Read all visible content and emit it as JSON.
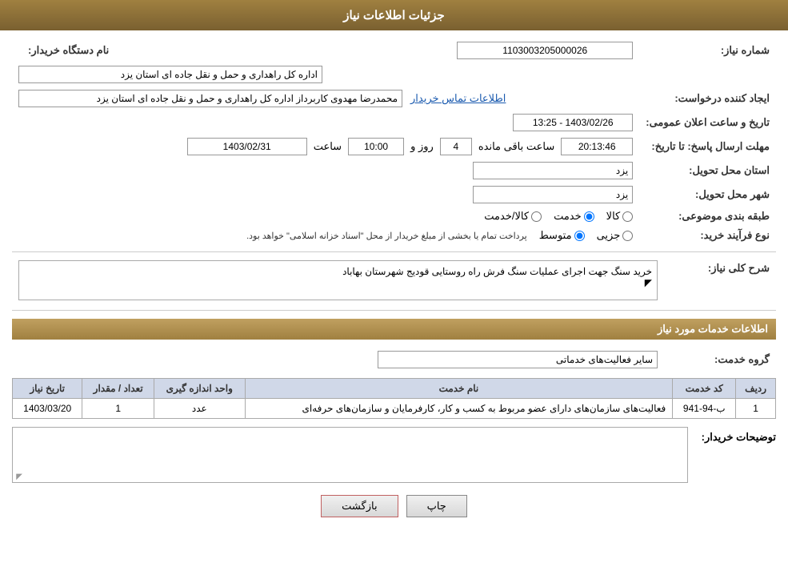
{
  "header": {
    "title": "جزئیات اطلاعات نیاز"
  },
  "main": {
    "need_number_label": "شماره نیاز:",
    "need_number_value": "1103003205000026",
    "buyer_org_label": "نام دستگاه خریدار:",
    "buyer_org_value": "اداره کل راهداری و حمل و نقل جاده ای استان یزد",
    "creator_label": "ایجاد کننده درخواست:",
    "creator_value": "محمدرضا مهدوی کاربرداز اداره کل راهداری و حمل و نقل جاده ای استان یزد",
    "creator_link": "اطلاعات تماس خریدار",
    "announce_date_label": "تاریخ و ساعت اعلان عمومی:",
    "announce_date_value": "1403/02/26 - 13:25",
    "response_date_label": "مهلت ارسال پاسخ: تا تاریخ:",
    "response_date_value": "1403/02/31",
    "response_time_label": "ساعت",
    "response_time_value": "10:00",
    "response_days_label": "روز و",
    "response_days_value": "4",
    "remaining_time_label": "ساعت باقی مانده",
    "remaining_time_value": "20:13:46",
    "province_label": "استان محل تحویل:",
    "province_value": "یزد",
    "city_label": "شهر محل تحویل:",
    "city_value": "یزد",
    "category_label": "طبقه بندی موضوعی:",
    "category_options": [
      {
        "id": "kala",
        "label": "کالا"
      },
      {
        "id": "khadamat",
        "label": "خدمت"
      },
      {
        "id": "kala_khadamat",
        "label": "کالا/خدمت"
      }
    ],
    "category_selected": "khadamat",
    "process_label": "نوع فرآیند خرید:",
    "process_options": [
      {
        "id": "jozvi",
        "label": "جزیی"
      },
      {
        "id": "motovaset",
        "label": "متوسط"
      }
    ],
    "process_selected": "motovaset",
    "process_note": "پرداخت تمام یا بخشی از مبلغ خریدار از محل \"اسناد خزانه اسلامی\" خواهد بود.",
    "description_label": "شرح کلی نیاز:",
    "description_value": "خرید سنگ جهت اجرای عملیات سنگ فرش راه روستایی قودیج شهرستان بهاباد",
    "services_section_title": "اطلاعات خدمات مورد نیاز",
    "service_group_label": "گروه خدمت:",
    "service_group_value": "سایر فعالیت‌های خدماتی",
    "table": {
      "columns": [
        "ردیف",
        "کد خدمت",
        "نام خدمت",
        "واحد اندازه گیری",
        "تعداد / مقدار",
        "تاریخ نیاز"
      ],
      "rows": [
        {
          "row": "1",
          "code": "ب-94-941",
          "service_name": "فعالیت‌های سازمان‌های دارای عضو مربوط به کسب و کار، کارفرمایان و سازمان‌های حرفه‌ای",
          "unit": "عدد",
          "quantity": "1",
          "date": "1403/03/20"
        }
      ]
    },
    "comments_label": "توضیحات خریدار:",
    "comments_value": "",
    "buttons": {
      "print": "چاپ",
      "back": "بازگشت"
    }
  }
}
